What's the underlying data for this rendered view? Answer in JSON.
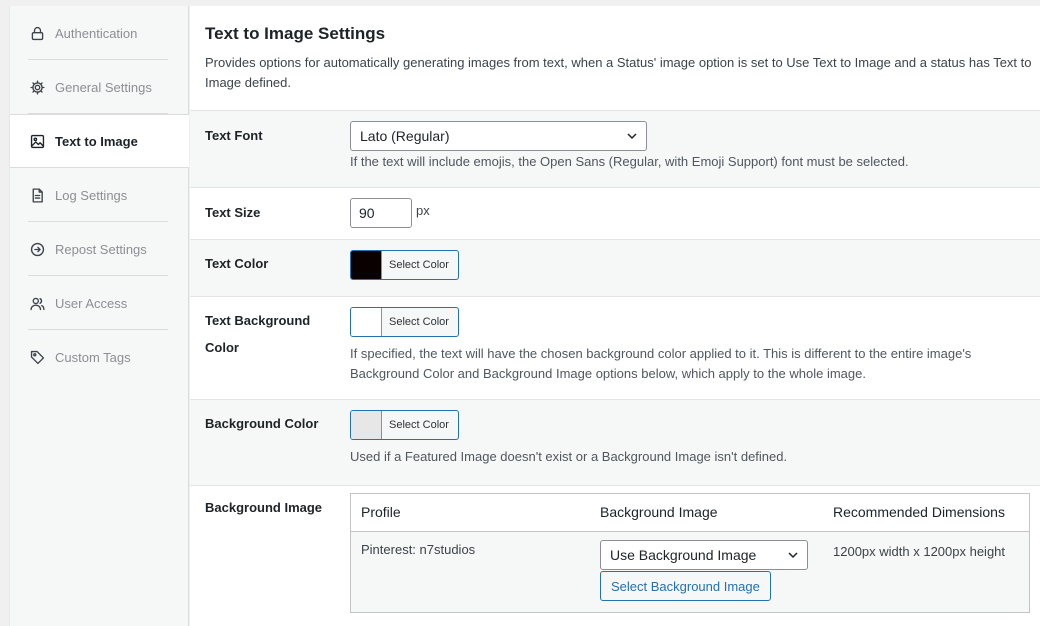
{
  "sidebar": {
    "items": [
      {
        "label": "Authentication",
        "icon": "lock-icon"
      },
      {
        "label": "General Settings",
        "icon": "gear-icon"
      },
      {
        "label": "Text to Image",
        "icon": "image-icon",
        "active": true
      },
      {
        "label": "Log Settings",
        "icon": "document-icon"
      },
      {
        "label": "Repost Settings",
        "icon": "arrow-circle-icon"
      },
      {
        "label": "User Access",
        "icon": "users-icon"
      },
      {
        "label": "Custom Tags",
        "icon": "tag-icon"
      }
    ]
  },
  "section": {
    "title": "Text to Image Settings",
    "description": "Provides options for automatically generating images from text, when a Status' image option is set to Use Text to Image and a status has Text to Image defined."
  },
  "fields": {
    "text_font": {
      "label": "Text Font",
      "value": "Lato (Regular)",
      "desc": "If the text will include emojis, the Open Sans (Regular, with Emoji Support) font must be selected."
    },
    "text_size": {
      "label": "Text Size",
      "value": "90",
      "unit": "px"
    },
    "text_color": {
      "label": "Text Color",
      "button": "Select Color",
      "swatch": "#0a0000"
    },
    "text_bg_color": {
      "label": "Text Background Color",
      "button": "Select Color",
      "swatch": "#ffffff",
      "desc": "If specified, the text will have the chosen background color applied to it. This is different to the entire image's Background Color and Background Image options below, which apply to the whole image."
    },
    "bg_color": {
      "label": "Background Color",
      "button": "Select Color",
      "swatch": "#e7e7e7",
      "desc": "Used if a Featured Image doesn't exist or a Background Image isn't defined."
    },
    "bg_image": {
      "label": "Background Image",
      "columns": [
        "Profile",
        "Background Image",
        "Recommended Dimensions"
      ],
      "rows": [
        {
          "profile": "Pinterest: n7studios",
          "select": "Use Background Image",
          "button": "Select Background Image",
          "dimensions": "1200px width x 1200px height"
        }
      ]
    }
  }
}
